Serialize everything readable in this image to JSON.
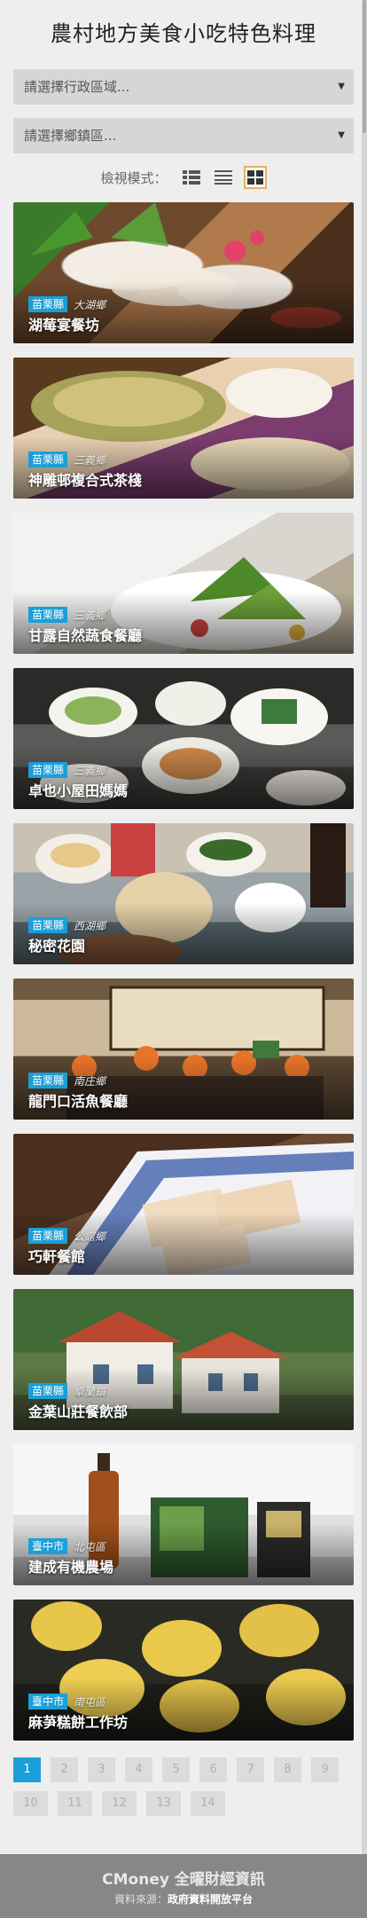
{
  "page": {
    "title": "農村地方美食小吃特色料理"
  },
  "filters": {
    "district": "請選擇行政區域...",
    "township": "請選擇鄉鎮區..."
  },
  "view_mode": {
    "label": "檢視模式：",
    "active": "grid"
  },
  "restaurants": [
    {
      "county": "苗栗縣",
      "town": "大湖鄉",
      "name": "湖莓宴餐坊"
    },
    {
      "county": "苗栗縣",
      "town": "三義鄉",
      "name": "神雕邨複合式茶棧"
    },
    {
      "county": "苗栗縣",
      "town": "三義鄉",
      "name": "甘露自然蔬食餐廳"
    },
    {
      "county": "苗栗縣",
      "town": "三義鄉",
      "name": "卓也小屋田媽媽"
    },
    {
      "county": "苗栗縣",
      "town": "西湖鄉",
      "name": "秘密花園"
    },
    {
      "county": "苗栗縣",
      "town": "南庄鄉",
      "name": "龍門口活魚餐廳"
    },
    {
      "county": "苗栗縣",
      "town": "公館鄉",
      "name": "巧軒餐館"
    },
    {
      "county": "苗栗縣",
      "town": "卓蘭鎮",
      "name": "金葉山莊餐飲部"
    },
    {
      "county": "臺中市",
      "town": "北屯區",
      "name": "建成有機農場"
    },
    {
      "county": "臺中市",
      "town": "南屯區",
      "name": "麻芛糕餅工作坊"
    }
  ],
  "pagination": {
    "current": 1,
    "pages": [
      "1",
      "2",
      "3",
      "4",
      "5",
      "6",
      "7",
      "8",
      "9",
      "10",
      "11",
      "12",
      "13",
      "14"
    ]
  },
  "footer": {
    "brand": "CMoney 全曜財經資訊",
    "source_label": "資料來源：",
    "source_value": "政府資料開放平台"
  },
  "colors": {
    "accent": "#1a9fd8",
    "active_view_border": "#e6b061",
    "footer_bg": "#878787"
  }
}
